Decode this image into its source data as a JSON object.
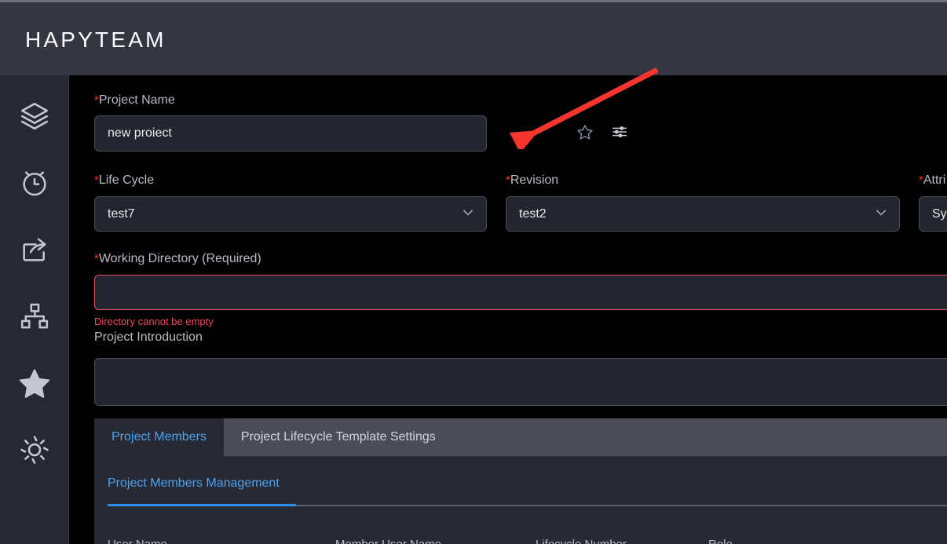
{
  "header": {
    "title": "HAPYTEAM",
    "background_color": "#343641"
  },
  "sidebar": {
    "background_color": "#262833",
    "items": [
      {
        "icon": "layers-icon",
        "label": ""
      },
      {
        "icon": "alarm-clock-icon",
        "label": ""
      },
      {
        "icon": "share-export-icon",
        "label": ""
      },
      {
        "icon": "sitemap-icon",
        "label": ""
      },
      {
        "icon": "star-filled-icon",
        "label": ""
      },
      {
        "icon": "gear-icon",
        "label": ""
      }
    ]
  },
  "form": {
    "project_name": {
      "label": "Project Name",
      "required_marker": "*",
      "value": "new proiect",
      "placeholder": ""
    },
    "favorite_icon": "star-outline-icon",
    "settings_icon": "sliders-icon",
    "life_cycle": {
      "label": "Life Cycle",
      "required_marker": "*",
      "value": "test7",
      "chevron_icon": "chevron-down-icon"
    },
    "revision": {
      "label": "Revision",
      "required_marker": "*",
      "value": "test2",
      "chevron_icon": "chevron-down-icon"
    },
    "attribute": {
      "label": "Attri",
      "required_marker": "*",
      "value": "Sy"
    },
    "working_directory": {
      "label": "Working Directory (Required)",
      "required_marker": "*",
      "value": "",
      "placeholder": "",
      "error": "Directory cannot be empty"
    },
    "project_introduction": {
      "label": "Project Introduction",
      "value": "",
      "placeholder": ""
    }
  },
  "tabs": {
    "items": [
      {
        "label": "Project Members",
        "active": true
      },
      {
        "label": "Project Lifecycle Template Settings",
        "active": false
      }
    ]
  },
  "panel": {
    "subtab_label": "Project Members Management",
    "table_headers": [
      "User Name",
      "Member User Name",
      "Lifecycle Number",
      "Role"
    ]
  },
  "annotation": {
    "type": "arrow",
    "color": "#f5352e",
    "points_to": "star-outline-icon"
  },
  "colors": {
    "page_background": "#000000",
    "panel_background": "#272934",
    "input_background": "#24262f",
    "accent_blue": "#4aa3f0",
    "error_red": "#f2495c",
    "required_red": "#ff2d2d",
    "tabstrip_background": "#4a4d57"
  }
}
